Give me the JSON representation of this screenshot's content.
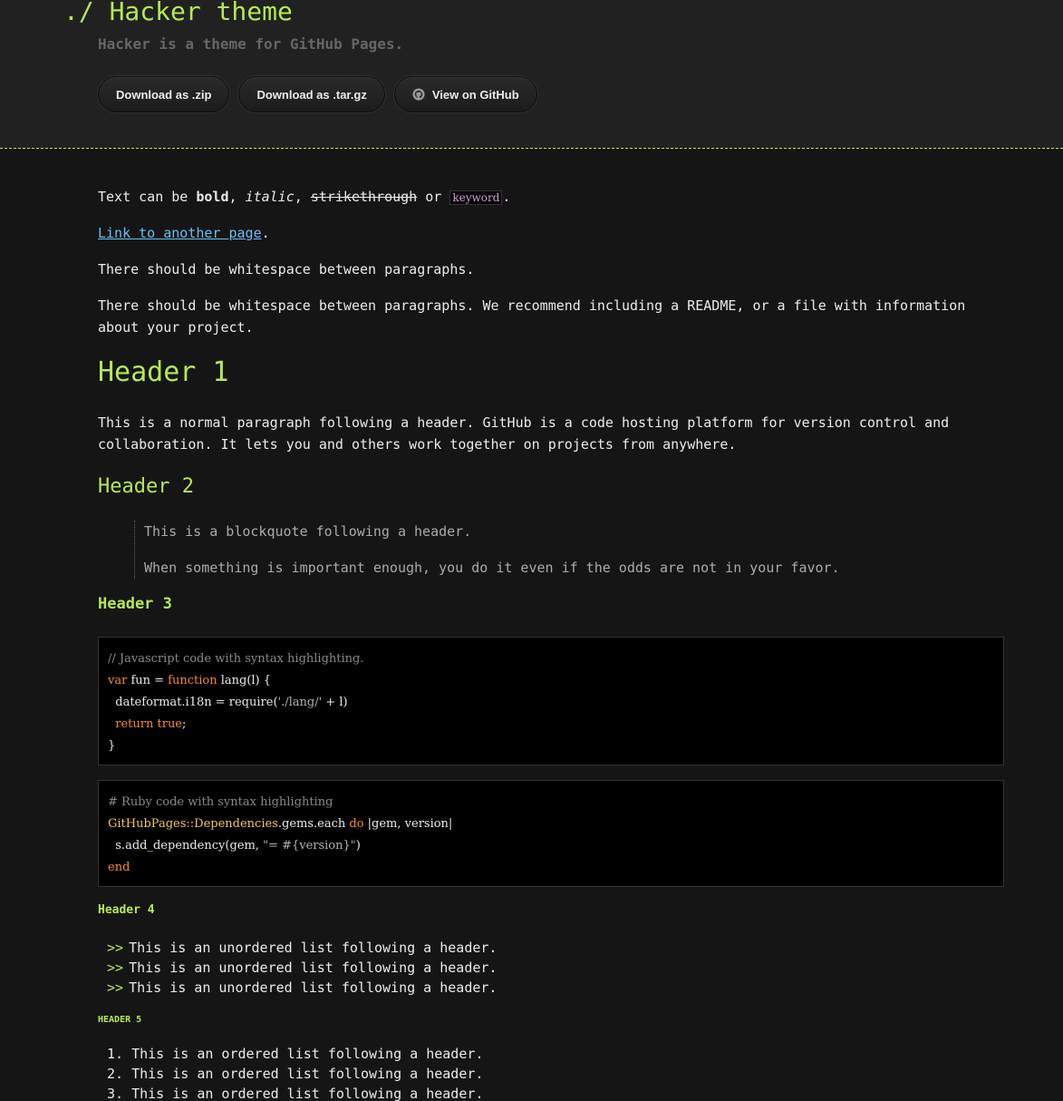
{
  "header": {
    "title": "./ Hacker theme",
    "tagline": "Hacker is a theme for GitHub Pages.",
    "buttons": {
      "zip": "Download as .zip",
      "tar": "Download as .tar.gz",
      "github": "View on GitHub"
    }
  },
  "content": {
    "p1": {
      "pre": "Text can be ",
      "bold": "bold",
      "sep1": ", ",
      "italic": "italic",
      "sep2": ", ",
      "strike": "strikethrough",
      "or": " or ",
      "keyword": "keyword",
      "end": "."
    },
    "p2": {
      "link": "Link to another page",
      "end": "."
    },
    "p3": "There should be whitespace between paragraphs.",
    "p4": "There should be whitespace between paragraphs. We recommend including a README, or a file with information about your project.",
    "h1": "Header 1",
    "p5": "This is a normal paragraph following a header. GitHub is a code hosting platform for version control and collaboration. It lets you and others work together on projects from anywhere.",
    "h2": "Header 2",
    "blockquote": [
      "This is a blockquote following a header.",
      "When something is important enough, you do it even if the odds are not in your favor."
    ],
    "h3": "Header 3",
    "code_js": {
      "comment": "// Javascript code with syntax highlighting.",
      "l2_var": "var",
      "l2_a": " fun = ",
      "l2_function": "function",
      "l2_b": " lang(l) {",
      "l3_a": "  dateformat.i18n = require(",
      "l3_str": "'./lang/'",
      "l3_b": " + l)",
      "l4_a": "  ",
      "l4_return": "return",
      "l4_sp": " ",
      "l4_true": "true",
      "l4_end": ";",
      "l5": "}"
    },
    "code_ruby": {
      "comment": "# Ruby code with syntax highlighting",
      "l2_const": "GitHubPages::Dependencies",
      "l2_a": ".gems.each ",
      "l2_do": "do",
      "l2_b": " |gem, version|",
      "l3_a": "  s.add_dependency(gem, ",
      "l3_str": "\"= #{version}\"",
      "l3_b": ")",
      "l4_end": "end"
    },
    "h4": "Header 4",
    "ul_bullet": ">>",
    "ul": [
      "This is an unordered list following a header.",
      "This is an unordered list following a header.",
      "This is an unordered list following a header."
    ],
    "h5": "Header 5",
    "ol": [
      "1. This is an ordered list following a header.",
      "2. This is an ordered list following a header.",
      "3. This is an ordered list following a header."
    ]
  },
  "colors": {
    "accent": "#b5e853",
    "link": "#63c0f5",
    "background": "#151515",
    "header_bg": "#212121"
  },
  "icons": {
    "github": "github-icon"
  }
}
